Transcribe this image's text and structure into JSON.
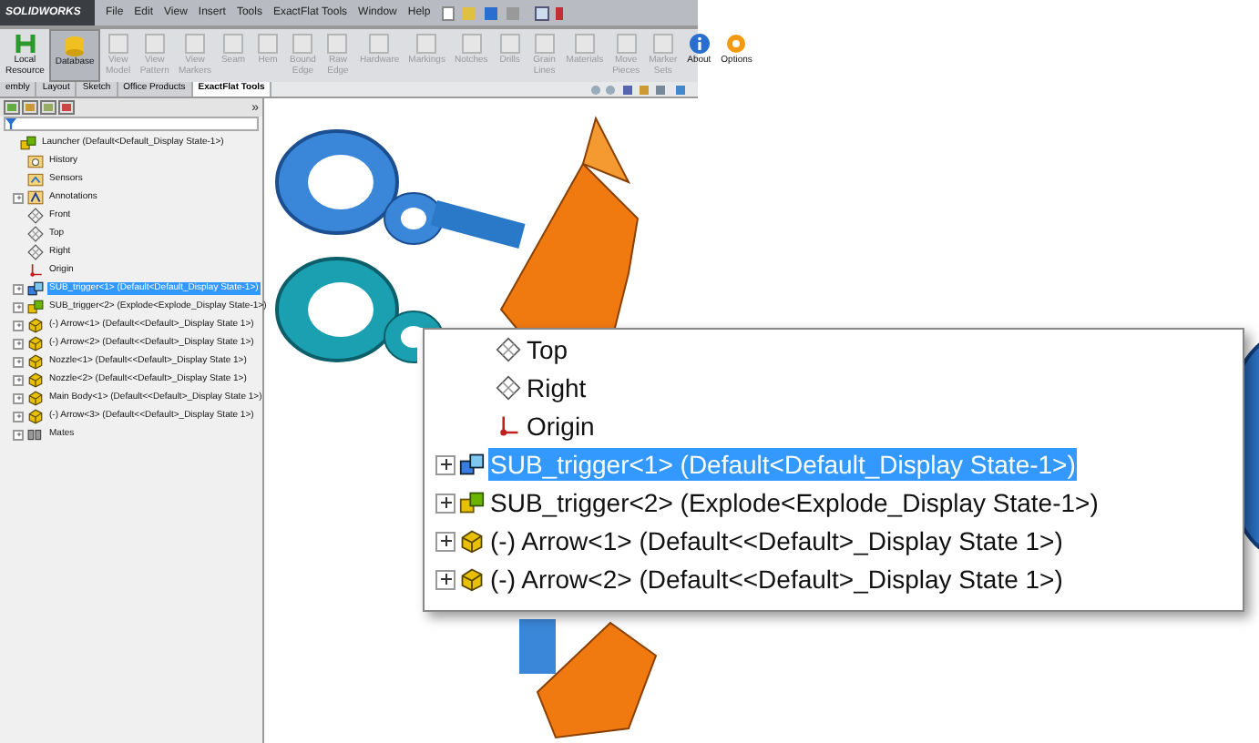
{
  "app": {
    "brand": "SOLIDWORKS",
    "menu": [
      "File",
      "Edit",
      "View",
      "Insert",
      "Tools",
      "ExactFlat Tools",
      "Window",
      "Help"
    ]
  },
  "ribbon": [
    {
      "lines": [
        "Local",
        "Resource"
      ],
      "selected": false,
      "disabled": false,
      "kind": "local"
    },
    {
      "lines": [
        "Database"
      ],
      "selected": true,
      "disabled": false,
      "kind": "database"
    },
    {
      "lines": [
        "View",
        "Model"
      ],
      "selected": false,
      "disabled": true,
      "kind": "generic"
    },
    {
      "lines": [
        "View",
        "Pattern"
      ],
      "selected": false,
      "disabled": true,
      "kind": "generic"
    },
    {
      "lines": [
        "View",
        "Markers"
      ],
      "selected": false,
      "disabled": true,
      "kind": "generic"
    },
    {
      "lines": [
        "Seam"
      ],
      "selected": false,
      "disabled": true,
      "kind": "generic"
    },
    {
      "lines": [
        "Hem"
      ],
      "selected": false,
      "disabled": true,
      "kind": "generic"
    },
    {
      "lines": [
        "Bound",
        "Edge"
      ],
      "selected": false,
      "disabled": true,
      "kind": "generic"
    },
    {
      "lines": [
        "Raw",
        "Edge"
      ],
      "selected": false,
      "disabled": true,
      "kind": "generic"
    },
    {
      "lines": [
        "Hardware"
      ],
      "selected": false,
      "disabled": true,
      "kind": "generic"
    },
    {
      "lines": [
        "Markings"
      ],
      "selected": false,
      "disabled": true,
      "kind": "generic"
    },
    {
      "lines": [
        "Notches"
      ],
      "selected": false,
      "disabled": true,
      "kind": "generic"
    },
    {
      "lines": [
        "Drills"
      ],
      "selected": false,
      "disabled": true,
      "kind": "generic"
    },
    {
      "lines": [
        "Grain",
        "Lines"
      ],
      "selected": false,
      "disabled": true,
      "kind": "generic"
    },
    {
      "lines": [
        "Materials"
      ],
      "selected": false,
      "disabled": true,
      "kind": "generic"
    },
    {
      "lines": [
        "Move",
        "Pieces"
      ],
      "selected": false,
      "disabled": true,
      "kind": "generic"
    },
    {
      "lines": [
        "Marker",
        "Sets"
      ],
      "selected": false,
      "disabled": true,
      "kind": "generic"
    },
    {
      "lines": [
        "About"
      ],
      "selected": false,
      "disabled": false,
      "kind": "about"
    },
    {
      "lines": [
        "Options"
      ],
      "selected": false,
      "disabled": false,
      "kind": "options"
    }
  ],
  "tabs": [
    {
      "label": "embly",
      "selected": false
    },
    {
      "label": "Layout",
      "selected": false
    },
    {
      "label": "Sketch",
      "selected": false
    },
    {
      "label": "Office Products",
      "selected": false
    },
    {
      "label": "ExactFlat Tools",
      "selected": true
    }
  ],
  "panel": {
    "collapse": "»",
    "tree": {
      "label": "Launcher  (Default<Default_Display State-1>)",
      "kind": "assembly",
      "children": [
        {
          "label": "History",
          "kind": "history"
        },
        {
          "label": "Sensors",
          "kind": "sensors"
        },
        {
          "label": "Annotations",
          "kind": "annotations",
          "expanded": false
        },
        {
          "label": "Front",
          "kind": "plane"
        },
        {
          "label": "Top",
          "kind": "plane"
        },
        {
          "label": "Right",
          "kind": "plane"
        },
        {
          "label": "Origin",
          "kind": "origin"
        },
        {
          "label": "SUB_trigger<1> (Default<Default_Display State-1>)",
          "kind": "subassembly",
          "expanded": false,
          "selected": true
        },
        {
          "label": "SUB_trigger<2> (Explode<Explode_Display State-1>)",
          "kind": "assembly",
          "expanded": false,
          "selected": false
        },
        {
          "label": "(-) Arrow<1>  (Default<<Default>_Display State 1>)",
          "kind": "part",
          "expanded": false,
          "selected": false
        },
        {
          "label": "(-) Arrow<2>  (Default<<Default>_Display State 1>)",
          "kind": "part",
          "expanded": false,
          "selected": false
        },
        {
          "label": "Nozzle<1>  (Default<<Default>_Display State 1>)",
          "kind": "part",
          "expanded": false,
          "selected": false
        },
        {
          "label": "Nozzle<2>  (Default<<Default>_Display State 1>)",
          "kind": "part",
          "expanded": false,
          "selected": false
        },
        {
          "label": "Main Body<1>  (Default<<Default>_Display State 1>)",
          "kind": "part",
          "expanded": false,
          "selected": false
        },
        {
          "label": "(-) Arrow<3>  (Default<<Default>_Display State 1>)",
          "kind": "part",
          "expanded": false,
          "selected": false
        },
        {
          "label": "Mates",
          "kind": "mates",
          "expanded": false
        }
      ]
    }
  },
  "callout": [
    {
      "label": "Top",
      "kind": "plane"
    },
    {
      "label": "Right",
      "kind": "plane"
    },
    {
      "label": "Origin",
      "kind": "origin"
    },
    {
      "label": "SUB_trigger<1> (Default<Default_Display State-1>)",
      "kind": "subassembly",
      "expanded": false,
      "selected": true
    },
    {
      "label": "SUB_trigger<2> (Explode<Explode_Display State-1>)",
      "kind": "assembly",
      "expanded": false,
      "selected": false
    },
    {
      "label": "(-) Arrow<1>  (Default<<Default>_Display State 1>)",
      "kind": "part",
      "expanded": false,
      "selected": false
    },
    {
      "label": "(-) Arrow<2>  (Default<<Default>_Display State 1>)",
      "kind": "part",
      "expanded": false,
      "selected": false
    }
  ]
}
